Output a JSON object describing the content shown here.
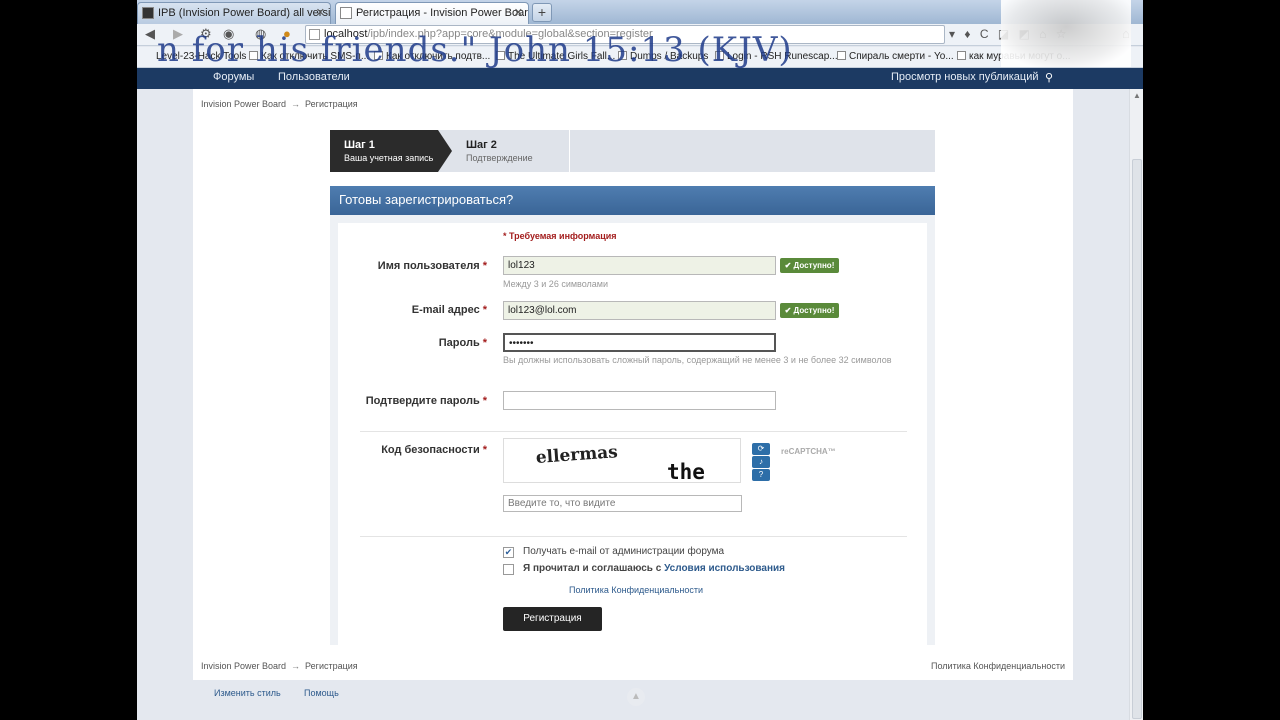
{
  "browser": {
    "tabs": [
      {
        "label": "IPB (Invision Power Board) all version..."
      },
      {
        "label": "Регистрация - Invision Power Board"
      }
    ],
    "new_tab": "+",
    "url_host": "localhost",
    "url_path": "/ipb/index.php?app=core&module=global&section=register",
    "bookmarks": [
      "Level-23-Hack Tools",
      "Как отключить SMS-п...",
      "Как отключить подтв...",
      "The Ultimate Girls Fall...",
      "Dumps / Backups",
      "Login - RSH Runescap...",
      "Спираль смерти - Yo...",
      "как муравьи могут о..."
    ],
    "overlay_text": "n for his friends.\" John 15:13 (KJV)"
  },
  "forum_nav": {
    "forums": "Форумы",
    "users": "Пользователи",
    "new_posts": "Просмотр новых публикаций"
  },
  "breadcrumb": {
    "home": "Invision Power Board",
    "arrow": "→",
    "current": "Регистрация"
  },
  "steps": [
    {
      "title": "Шаг 1",
      "subtitle": "Ваша учетная запись"
    },
    {
      "title": "Шаг 2",
      "subtitle": "Подтверждение"
    }
  ],
  "panel_title": "Готовы зарегистрироваться?",
  "required_note": "* Требуемая информация",
  "form": {
    "username": {
      "label": "Имя пользователя",
      "value": "lol123",
      "hint": "Между 3 и 26 символами",
      "status": "✔ Доступно!"
    },
    "email": {
      "label": "E-mail адрес",
      "value": "lol123@lol.com",
      "status": "✔ Доступно!"
    },
    "password": {
      "label": "Пароль",
      "value": "•••••••",
      "hint": "Вы должны использовать сложный пароль, содержащий не менее 3 и не более 32 символов"
    },
    "confirm": {
      "label": "Подтвердите пароль",
      "value": ""
    },
    "captcha": {
      "label": "Код безопасности",
      "word1": "ellermas",
      "word2": "the",
      "placeholder": "Введите то, что видите",
      "brand": "reCAPTCHA™"
    },
    "required_star": "*"
  },
  "options": {
    "admin_email": {
      "label": "Получать e-mail от администрации форума",
      "checked": true
    },
    "terms": {
      "label_prefix": "Я прочитал и соглашаюсь с",
      "link": "Условия использования",
      "checked": false
    },
    "privacy": "Политика Конфиденциальности"
  },
  "submit_label": "Регистрация",
  "footer": {
    "privacy": "Политика Конфиденциальности",
    "change_style": "Изменить стиль",
    "help": "Помощь"
  }
}
